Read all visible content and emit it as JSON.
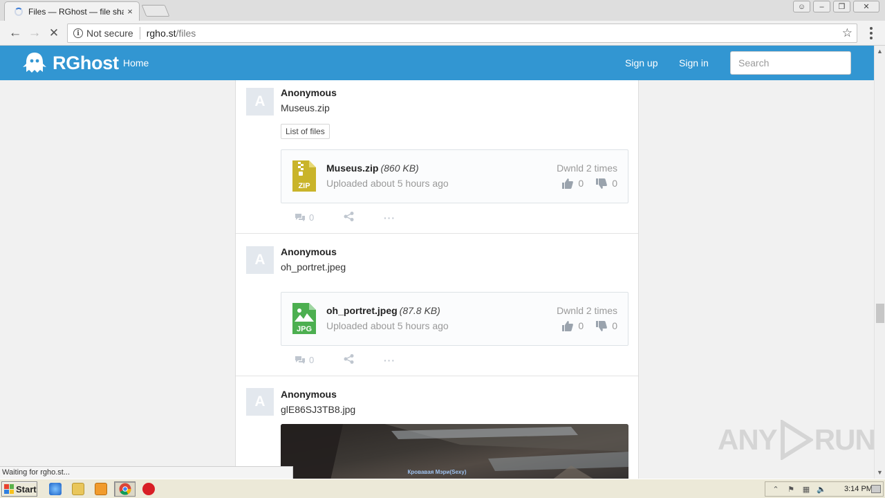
{
  "browser": {
    "tab_title": "Files — RGhost — file sharin",
    "tab_close": "×",
    "url_security": "Not secure",
    "url_host": "rgho.st",
    "url_path": "/files",
    "status_text": "Waiting for rgho.st..."
  },
  "site": {
    "logo_text": "RGhost",
    "nav_home": "Home",
    "nav_signup": "Sign up",
    "nav_signin": "Sign in",
    "search_placeholder": "Search",
    "brand_color": "#3296d2"
  },
  "posts": [
    {
      "avatar_letter": "A",
      "author": "Anonymous",
      "title": "Museus.zip",
      "list_button": "List of files",
      "file": {
        "name": "Museus.zip",
        "size": "(860 KB)",
        "uploaded": "Uploaded about 5 hours ago",
        "downloads": "Dwnld 2 times",
        "likes": "0",
        "dislikes": "0",
        "icon": "zip-file-icon",
        "icon_label": "ZIP",
        "icon_color": "#c9b42a"
      },
      "comments": "0"
    },
    {
      "avatar_letter": "A",
      "author": "Anonymous",
      "title": "oh_portret.jpeg",
      "file": {
        "name": "oh_portret.jpeg",
        "size": "(87.8 KB)",
        "uploaded": "Uploaded about 5 hours ago",
        "downloads": "Dwnld 2 times",
        "likes": "0",
        "dislikes": "0",
        "icon": "jpg-file-icon",
        "icon_label": "JPG",
        "icon_color": "#4caf50"
      },
      "comments": "0"
    },
    {
      "avatar_letter": "A",
      "author": "Anonymous",
      "title": "glE86SJ3TB8.jpg",
      "preview_caption": "Кровавая Мэри(Sexy)"
    }
  ],
  "taskbar": {
    "start_label": "Start",
    "clock": "3:14 PM"
  },
  "watermark": {
    "left": "ANY",
    "right": "RUN"
  }
}
